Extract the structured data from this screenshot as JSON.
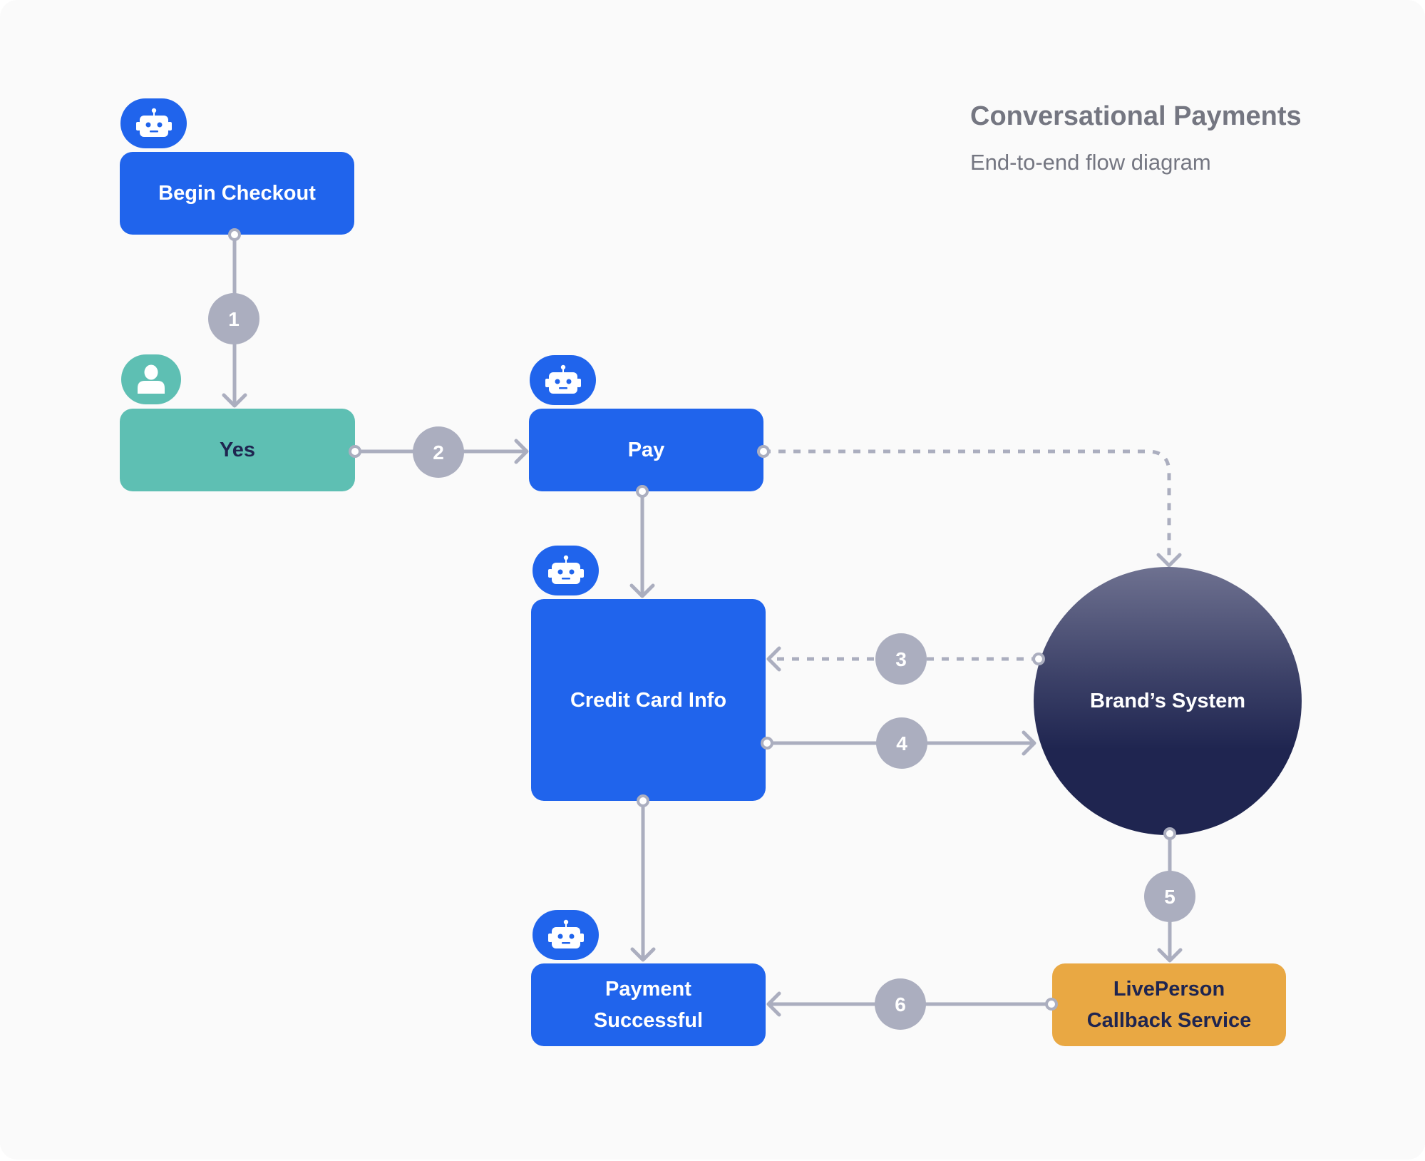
{
  "header": {
    "title": "Conversational Payments",
    "subtitle": "End-to-end flow diagram"
  },
  "colors": {
    "bot_blue": "#2064ec",
    "user_teal": "#5ebfb3",
    "service_orange": "#e9a843",
    "system_navy": "#1f2550",
    "connector_gray": "#abaebf",
    "heading_gray": "#747681"
  },
  "nodes": {
    "begin_checkout": {
      "label": "Begin Checkout",
      "actor": "bot"
    },
    "yes": {
      "label": "Yes",
      "actor": "user"
    },
    "pay": {
      "label": "Pay",
      "actor": "bot"
    },
    "credit_card_info": {
      "label": "Credit Card Info",
      "actor": "bot"
    },
    "payment_successful": {
      "label": "Payment Successful",
      "line1": "Payment",
      "line2": "Successful",
      "actor": "bot"
    },
    "brands_system": {
      "label": "Brand’s System"
    },
    "liveperson_callback": {
      "label": "LivePerson Callback Service",
      "line1": "LivePerson",
      "line2": "Callback Service"
    }
  },
  "icons": {
    "bot": "robot-icon",
    "user": "user-icon"
  },
  "edges": [
    {
      "step": "1",
      "from": "Begin Checkout",
      "to": "Yes",
      "style": "solid"
    },
    {
      "step": "2",
      "from": "Yes",
      "to": "Pay",
      "style": "solid"
    },
    {
      "step": "",
      "from": "Pay",
      "to": "Brand’s System",
      "style": "dashed"
    },
    {
      "step": "",
      "from": "Pay",
      "to": "Credit Card Info",
      "style": "solid"
    },
    {
      "step": "3",
      "from": "Brand’s System",
      "to": "Credit Card Info",
      "style": "dashed"
    },
    {
      "step": "4",
      "from": "Credit Card Info",
      "to": "Brand’s System",
      "style": "solid"
    },
    {
      "step": "",
      "from": "Credit Card Info",
      "to": "Payment Successful",
      "style": "solid"
    },
    {
      "step": "5",
      "from": "Brand’s System",
      "to": "LivePerson Callback Service",
      "style": "solid"
    },
    {
      "step": "6",
      "from": "LivePerson Callback Service",
      "to": "Payment Successful",
      "style": "solid"
    }
  ]
}
